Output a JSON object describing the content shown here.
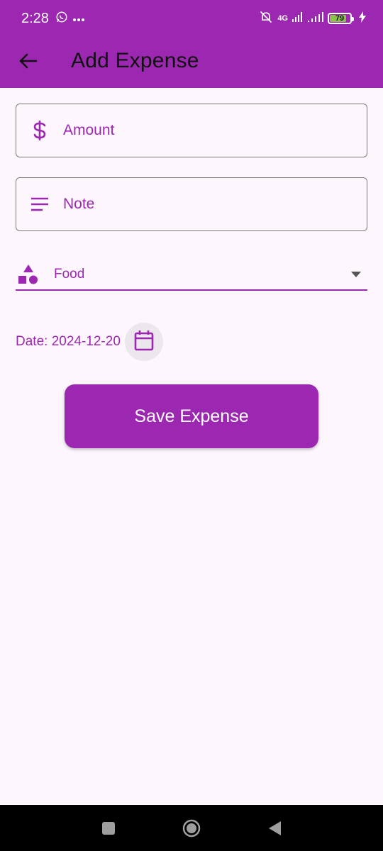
{
  "status_bar": {
    "time": "2:28",
    "network": "4G",
    "battery": "79",
    "icons": [
      "whatsapp-icon",
      "more-dots-icon",
      "mute-bell-icon",
      "signal-icon",
      "signal-icon-2",
      "battery-icon",
      "charging-icon"
    ]
  },
  "app_bar": {
    "title": "Add Expense",
    "back_icon": "arrow-back-icon"
  },
  "form": {
    "amount": {
      "placeholder": "Amount",
      "value": "",
      "icon": "dollar-icon"
    },
    "note": {
      "placeholder": "Note",
      "value": "",
      "icon": "notes-lines-icon"
    },
    "category": {
      "selected": "Food",
      "icon": "category-shapes-icon"
    },
    "date_label": "Date: 2024-12-20",
    "save_label": "Save Expense"
  },
  "colors": {
    "primary": "#9c27b0",
    "background": "#fdf6fd",
    "calendar_button_bg": "#ece6ed"
  },
  "nav_bar": {
    "icons": [
      "recents-square-icon",
      "home-circle-icon",
      "back-triangle-icon"
    ]
  }
}
